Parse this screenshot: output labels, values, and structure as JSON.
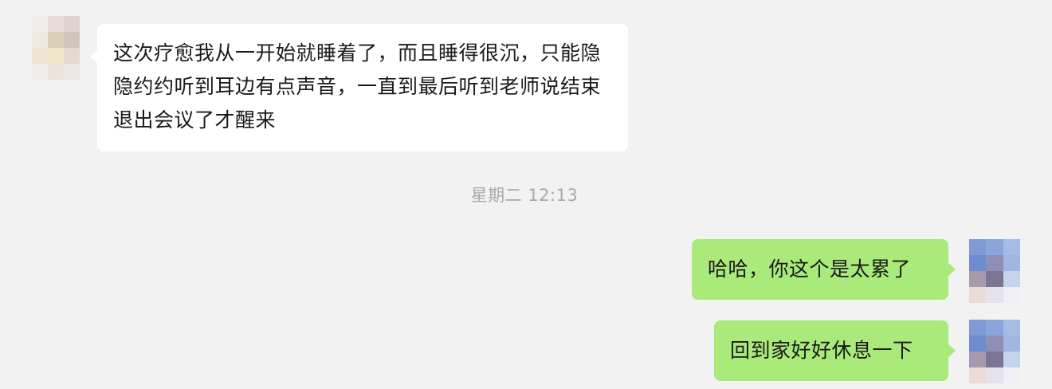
{
  "messages": [
    {
      "direction": "incoming",
      "text": "这次疗愈我从一开始就睡着了，而且睡得很沉，只能隐隐约约听到耳边有点声音，一直到最后听到老师说结束退出会议了才醒来"
    },
    {
      "direction": "outgoing",
      "text": "哈哈，你这个是太累了"
    },
    {
      "direction": "outgoing",
      "text": "回到家好好休息一下"
    }
  ],
  "timestamp": "星期二 12:13",
  "colors": {
    "background": "#f2f2f2",
    "incoming_bubble": "#ffffff",
    "outgoing_bubble": "#a9ea7a",
    "timestamp_text": "#a8a8a8"
  }
}
